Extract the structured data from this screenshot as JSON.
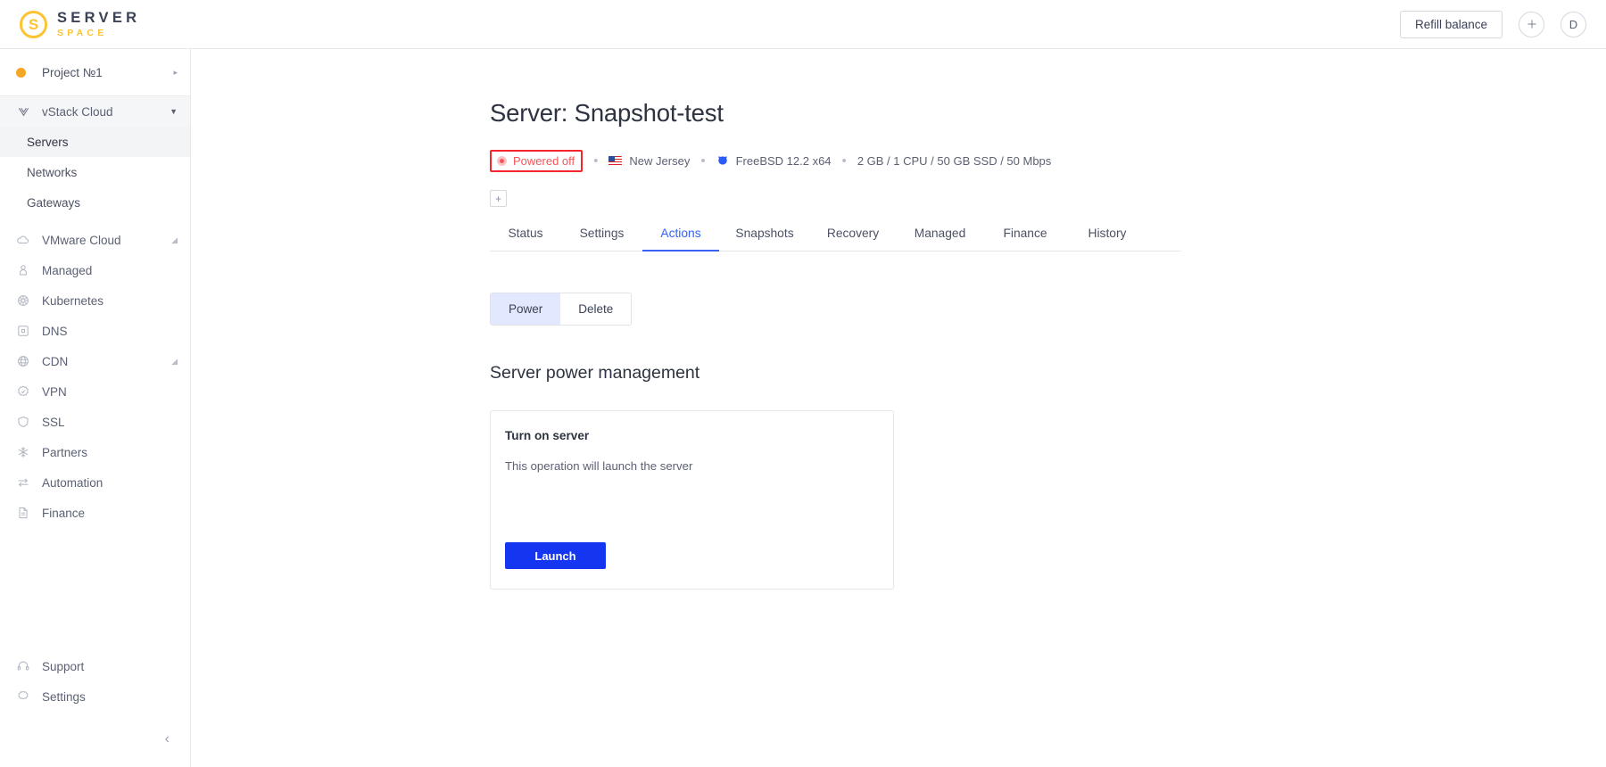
{
  "brand": {
    "mark_letter": "S",
    "title": "SERVER",
    "subtitle": "SPACE"
  },
  "topbar": {
    "refill_label": "Refill balance",
    "add_label": "+",
    "avatar_label": "D"
  },
  "sidebar": {
    "project": {
      "label": "Project №1",
      "arrow": "▸"
    },
    "group": {
      "label": "vStack Cloud",
      "caret": "▼",
      "icon": "vstack-icon"
    },
    "subitems": [
      {
        "label": "Servers",
        "active": true
      },
      {
        "label": "Networks",
        "active": false
      },
      {
        "label": "Gateways",
        "active": false
      }
    ],
    "items": [
      {
        "label": "VMware Cloud",
        "icon": "cloud-icon",
        "caret": "◢"
      },
      {
        "label": "Managed",
        "icon": "user-lock-icon",
        "caret": ""
      },
      {
        "label": "Kubernetes",
        "icon": "kubernetes-icon",
        "caret": ""
      },
      {
        "label": "DNS",
        "icon": "dns-box-icon",
        "caret": ""
      },
      {
        "label": "CDN",
        "icon": "globe-icon",
        "caret": "◢"
      },
      {
        "label": "VPN",
        "icon": "vpn-badge-icon",
        "caret": ""
      },
      {
        "label": "SSL",
        "icon": "shield-icon",
        "caret": ""
      },
      {
        "label": "Partners",
        "icon": "snowflake-icon",
        "caret": ""
      },
      {
        "label": "Automation",
        "icon": "transfer-icon",
        "caret": ""
      },
      {
        "label": "Finance",
        "icon": "document-icon",
        "caret": ""
      }
    ],
    "bottom_items": [
      {
        "label": "Support",
        "icon": "headset-icon"
      },
      {
        "label": "Settings",
        "icon": "gear-icon"
      }
    ],
    "collapse": "‹"
  },
  "page": {
    "title": "Server: Snapshot-test",
    "status": {
      "text": "Powered off",
      "color": "#F4565C",
      "highlight_color": "#F5252D"
    },
    "location": "New Jersey",
    "os": "FreeBSD 12.2 x64",
    "specs": "2 GB / 1 CPU / 50 GB SSD / 50 Mbps",
    "separator": "•",
    "add_tag": "+"
  },
  "tabs": [
    {
      "label": "Status",
      "active": false
    },
    {
      "label": "Settings",
      "active": false
    },
    {
      "label": "Actions",
      "active": true
    },
    {
      "label": "Snapshots",
      "active": false
    },
    {
      "label": "Recovery",
      "active": false
    },
    {
      "label": "Managed",
      "active": false
    },
    {
      "label": "Finance",
      "active": false
    },
    {
      "label": "History",
      "active": false
    }
  ],
  "segmented": [
    {
      "label": "Power",
      "active": true
    },
    {
      "label": "Delete",
      "active": false
    }
  ],
  "section": {
    "title": "Server power management"
  },
  "card": {
    "title": "Turn on server",
    "description": "This operation will launch the server",
    "button_label": "Launch",
    "button_color": "#1436F0"
  }
}
